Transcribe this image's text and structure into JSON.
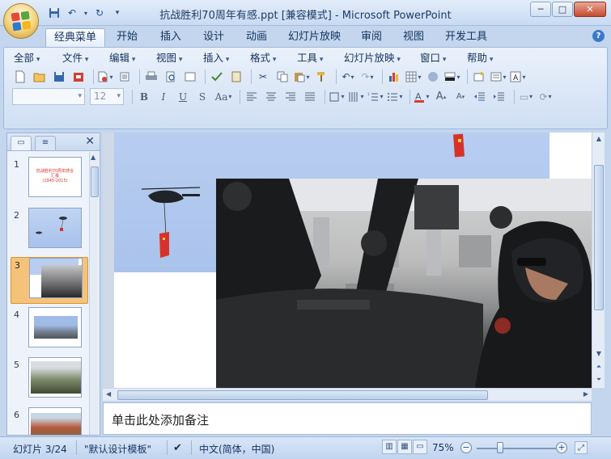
{
  "window": {
    "title": "抗战胜利70周年有感.ppt [兼容模式] - Microsoft PowerPoint",
    "minimize": "─",
    "maximize": "□",
    "close": "✕"
  },
  "qat": {
    "save_icon": "save-icon",
    "undo_icon": "undo-icon",
    "redo_icon": "redo-icon",
    "customize_icon": "qat-customize-icon"
  },
  "ribbon_tabs": [
    {
      "label": "经典菜单",
      "active": true
    },
    {
      "label": "开始"
    },
    {
      "label": "插入"
    },
    {
      "label": "设计"
    },
    {
      "label": "动画"
    },
    {
      "label": "幻灯片放映"
    },
    {
      "label": "审阅"
    },
    {
      "label": "视图"
    },
    {
      "label": "开发工具"
    }
  ],
  "menus": [
    "全部",
    "文件",
    "编辑",
    "视图",
    "插入",
    "格式",
    "工具",
    "幻灯片放映",
    "窗口",
    "帮助"
  ],
  "format": {
    "font_name": "",
    "font_size": "12",
    "bold": "B",
    "italic": "I",
    "underline": "U",
    "shadow": "S",
    "change_case": "Aa"
  },
  "slides": [
    {
      "number": "1",
      "line1": "抗战胜利70周年感言",
      "line2": "汇报",
      "line3": "(1945-2015)"
    },
    {
      "number": "2"
    },
    {
      "number": "3",
      "selected": true
    },
    {
      "number": "4"
    },
    {
      "number": "5"
    },
    {
      "number": "6"
    }
  ],
  "notes": {
    "placeholder": "单击此处添加备注"
  },
  "status": {
    "slide_info": "幻灯片 3/24",
    "template": "\"默认设计模板\"",
    "language": "中文(简体，中国)",
    "zoom": "75%",
    "zoom_level": 0.3
  },
  "colors": {
    "accent": "#15325e",
    "selected_slide": "#f5c27a",
    "sky": "#aac3ec",
    "flag": "#e0382f"
  }
}
